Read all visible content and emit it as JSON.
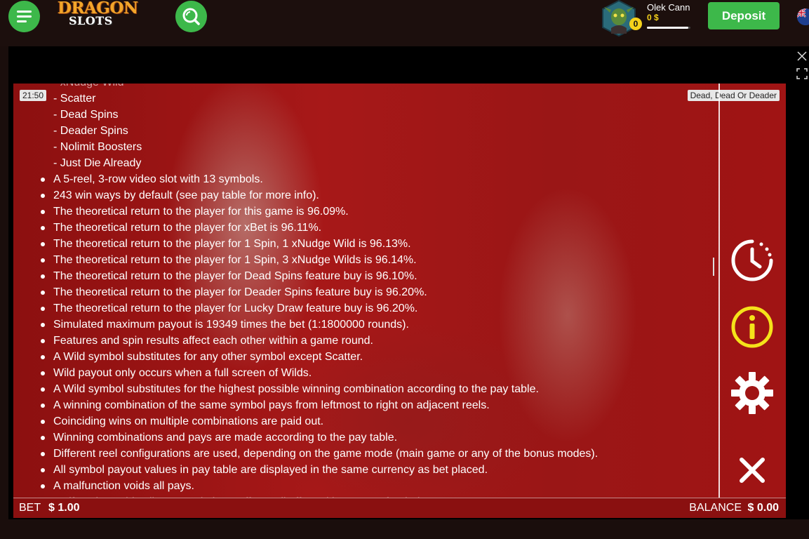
{
  "header": {
    "logo_line1": "DRAGON",
    "logo_line2": "SLOTS",
    "username": "Olek Cann",
    "balance": "0 $",
    "level_badge": "0",
    "level_progress": 0.95,
    "deposit_label": "Deposit"
  },
  "game": {
    "clock": "21:50",
    "title": "Dead, Dead Or Deader",
    "rules_sub": [
      "- xNudge Wild",
      "- Scatter",
      "- Dead Spins",
      "- Deader Spins",
      "- Nolimit Boosters",
      "- Just Die Already"
    ],
    "rules_bullets": [
      "A 5-reel, 3-row video slot with 13 symbols.",
      "243 win ways by default (see pay table for more info).",
      "The theoretical return to the player for this game is 96.09%.",
      "The theoretical return to the player for xBet is 96.11%.",
      "The theoretical return to the player for 1 Spin, 1 xNudge Wild is 96.13%.",
      "The theoretical return to the player for 1 Spin, 3 xNudge Wilds is 96.14%.",
      "The theoretical return to the player for Dead Spins feature buy is 96.10%.",
      "The theoretical return to the player for Deader Spins feature buy is 96.20%.",
      "The theoretical return to the player for Lucky Draw feature buy is 96.20%.",
      "Simulated maximum payout is 19349 times the bet (1:1800000 rounds).",
      "Features and spin results affect each other within a game round.",
      "A Wild symbol substitutes for any other symbol except Scatter.",
      "Wild payout only occurs when a full screen of Wilds.",
      "A Wild symbol substitutes for the highest possible winning combination according to the pay table.",
      "A winning combination of the same symbol pays from leftmost to right on adjacent reels.",
      "Coinciding wins on multiple combinations are paid out.",
      "Winning combinations and pays are made according to the pay table.",
      "Different reel configurations are used, depending on the game mode (main game or any of the bonus modes).",
      "All symbol payout values in pay table are displayed in the same currency as bet placed.",
      "A malfunction voids all pays.",
      "Malfunction voids all pays and plays, affects all affected bets are refunded."
    ],
    "bet_label": "BET",
    "bet_value": "$ 1.00",
    "balance_label": "BALANCE",
    "balance_value": "$ 0.00"
  },
  "icons": {
    "menu": "hamburger-icon",
    "search": "search-icon",
    "history": "history-clock-icon",
    "info": "info-icon",
    "settings": "gear-icon",
    "close": "close-icon",
    "fullscreen": "fullscreen-icon"
  },
  "colors": {
    "accent_green": "#3db84a",
    "info_yellow": "#f5e31a",
    "game_red": "#a01414"
  }
}
